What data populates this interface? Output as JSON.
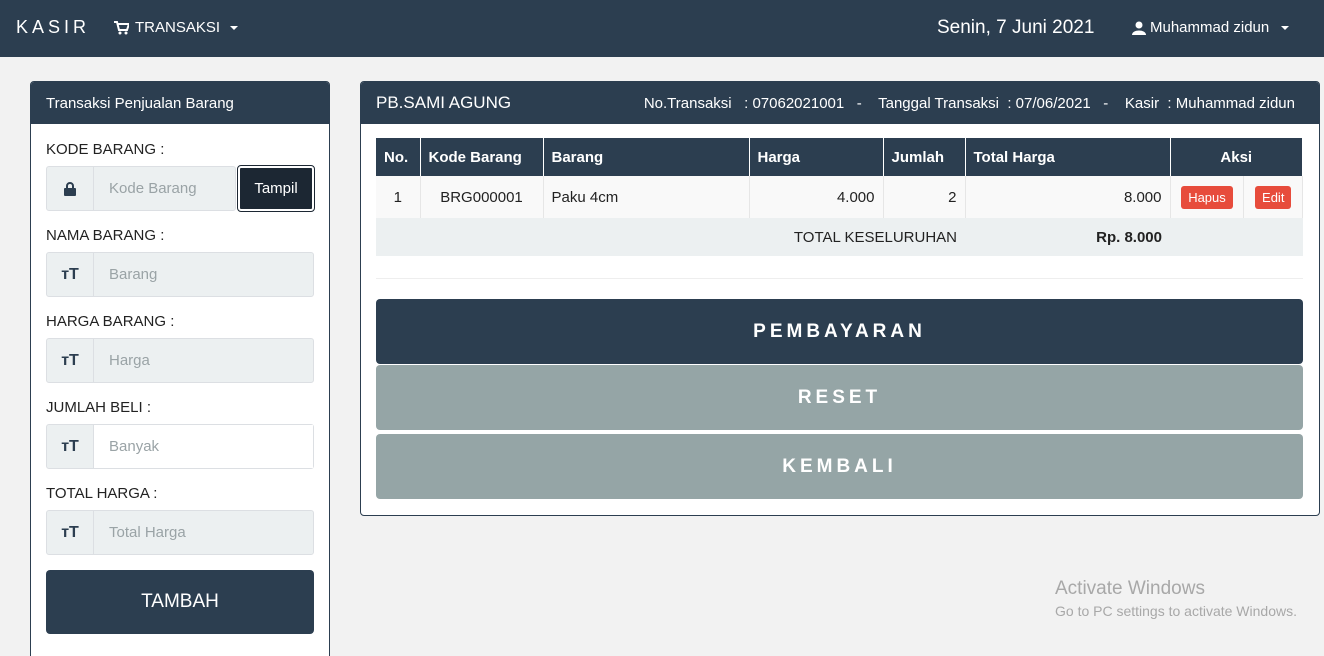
{
  "navbar": {
    "brand": "KASIR",
    "transaksi": "TRANSAKSI",
    "date": "Senin, 7 Juni 2021",
    "user": "Muhammad zidun"
  },
  "left": {
    "title": "Transaksi Penjualan Barang",
    "kode_label": "KODE BARANG :",
    "kode_placeholder": "Kode  Barang",
    "tampil": "Tampil",
    "nama_label": "NAMA BARANG :",
    "nama_placeholder": "Barang",
    "harga_label": "HARGA BARANG :",
    "harga_placeholder": "Harga",
    "jumlah_label": "JUMLAH BELI :",
    "jumlah_placeholder": "Banyak",
    "total_label": "TOTAL HARGA :",
    "total_placeholder": "Total Harga",
    "tambah": "TAMBAH"
  },
  "right": {
    "store": "PB.SAMI AGUNG",
    "trans_info": "No.Transaksi   : 07062021001   -    Tanggal Transaksi  : 07/06/2021   -    Kasir  : Muhammad zidun",
    "headers": [
      "No.",
      "Kode Barang",
      "Barang",
      "Harga",
      "Jumlah",
      "Total Harga",
      "Aksi"
    ],
    "rows": [
      {
        "no": "1",
        "kode": "BRG000001",
        "barang": "Paku 4cm",
        "harga": "4.000",
        "jumlah": "2",
        "total": "8.000",
        "hapus": "Hapus",
        "edit": "Edit"
      }
    ],
    "total_label": "TOTAL KESELURUHAN",
    "total_value": "Rp. 8.000",
    "pembayaran": "PEMBAYARAN",
    "reset": "RESET",
    "kembali": "KEMBALI"
  },
  "watermark": {
    "line1": "Activate Windows",
    "line2": "Go to PC settings to activate Windows."
  }
}
